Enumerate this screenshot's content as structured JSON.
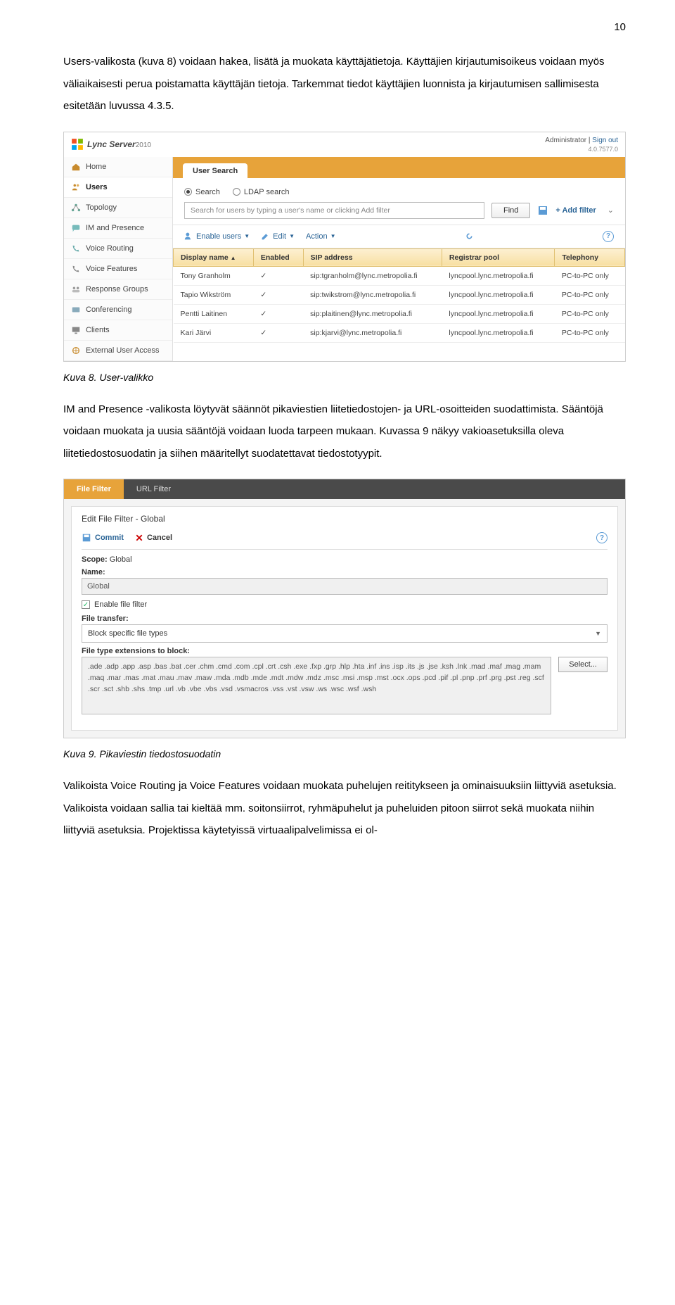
{
  "page_number": "10",
  "para1": "Users-valikosta (kuva 8) voidaan hakea, lisätä ja muokata käyttäjätietoja. Käyttäjien kirjautumisoikeus voidaan myös väliaikaisesti perua poistamatta käyttäjän tietoja. Tarkemmat tiedot käyttäjien luonnista ja kirjautumisen sallimisesta esitetään luvussa 4.3.5.",
  "lync": {
    "product": "Lync Server",
    "year": "2010",
    "admin": "Administrator",
    "signout": "Sign out",
    "version": "4.0.7577.0",
    "sidebar": [
      "Home",
      "Users",
      "Topology",
      "IM and Presence",
      "Voice Routing",
      "Voice Features",
      "Response Groups",
      "Conferencing",
      "Clients",
      "External User Access"
    ],
    "tab": "User Search",
    "opt_search": "Search",
    "opt_ldap": "LDAP search",
    "placeholder": "Search for users by typing a user's name or clicking Add filter",
    "find": "Find",
    "addfilter": "+ Add filter",
    "toolbar": {
      "enable": "Enable users",
      "edit": "Edit",
      "action": "Action"
    },
    "headers": [
      "Display name",
      "Enabled",
      "SIP address",
      "Registrar pool",
      "Telephony"
    ],
    "rows": [
      {
        "name": "Tony Granholm",
        "enabled": "✓",
        "sip": "sip:tgranholm@lync.metropolia.fi",
        "pool": "lyncpool.lync.metropolia.fi",
        "tel": "PC-to-PC only"
      },
      {
        "name": "Tapio Wikström",
        "enabled": "✓",
        "sip": "sip:twikstrom@lync.metropolia.fi",
        "pool": "lyncpool.lync.metropolia.fi",
        "tel": "PC-to-PC only"
      },
      {
        "name": "Pentti Laitinen",
        "enabled": "✓",
        "sip": "sip:plaitinen@lync.metropolia.fi",
        "pool": "lyncpool.lync.metropolia.fi",
        "tel": "PC-to-PC only"
      },
      {
        "name": "Kari Järvi",
        "enabled": "✓",
        "sip": "sip:kjarvi@lync.metropolia.fi",
        "pool": "lyncpool.lync.metropolia.fi",
        "tel": "PC-to-PC only"
      }
    ]
  },
  "caption1": "Kuva 8. User-valikko",
  "para2": "IM and Presence -valikosta löytyvät säännöt pikaviestien liitetiedostojen- ja URL-osoitteiden suodattimista. Sääntöjä voidaan muokata ja uusia sääntöjä voidaan luoda tarpeen mukaan. Kuvassa 9 näkyy vakioasetuksilla oleva liitetiedostosuodatin ja siihen määritellyt suodatettavat tiedostotyypit.",
  "ff": {
    "tab_file": "File Filter",
    "tab_url": "URL Filter",
    "title": "Edit File Filter - Global",
    "commit": "Commit",
    "cancel": "Cancel",
    "scope_label": "Scope:",
    "scope_val": "Global",
    "name_label": "Name:",
    "name_val": "Global",
    "enable": "Enable file filter",
    "ft_label": "File transfer:",
    "ft_val": "Block specific file types",
    "ext_label": "File type extensions to block:",
    "ext_val": ".ade .adp .app .asp .bas .bat .cer .chm .cmd .com .cpl .crt .csh .exe .fxp .grp .hlp .hta .inf .ins .isp .its .js .jse .ksh .lnk .mad .maf .mag .mam .maq .mar .mas .mat .mau .mav .maw .mda .mdb .mde .mdt .mdw .mdz .msc .msi .msp .mst .ocx .ops .pcd .pif .pl .pnp .prf .prg .pst .reg .scf .scr .sct .shb .shs .tmp .url .vb .vbe .vbs .vsd .vsmacros .vss .vst .vsw .ws .wsc .wsf .wsh",
    "select": "Select..."
  },
  "caption2": "Kuva 9. Pikaviestin tiedostosuodatin",
  "para3": "Valikoista Voice Routing ja Voice Features voidaan muokata puhelujen reititykseen ja ominaisuuksiin liittyviä asetuksia. Valikoista voidaan sallia tai kieltää mm. soitonsiirrot, ryhmäpuhelut ja puheluiden pitoon siirrot sekä muokata niihin liittyviä asetuksia. Projektissa käytetyissä virtuaalipalvelimissa ei ol-"
}
